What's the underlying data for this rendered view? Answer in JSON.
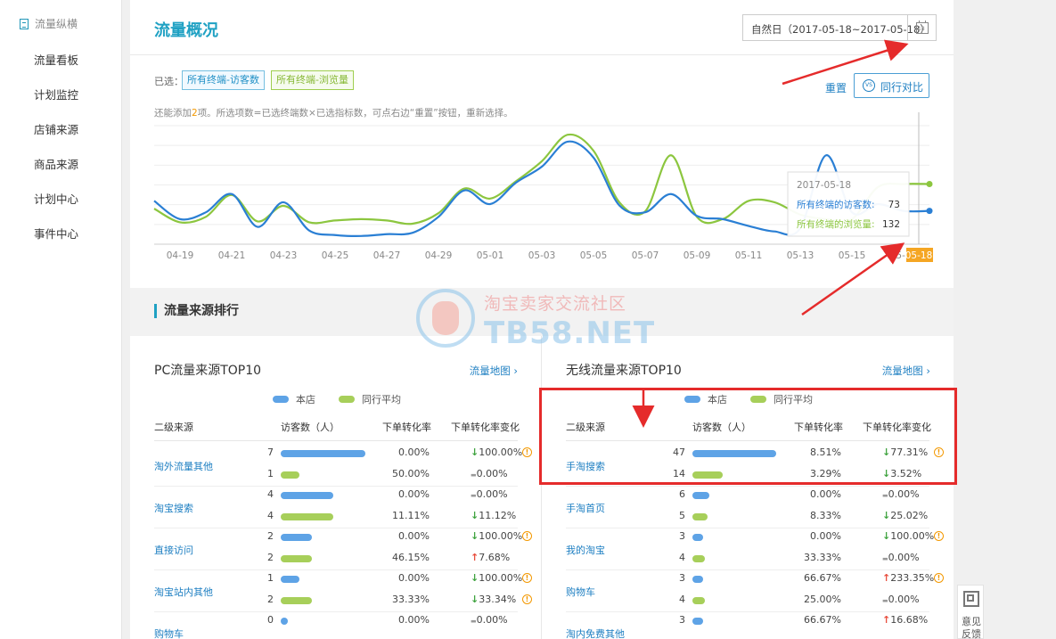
{
  "sidebar": {
    "header": "流量纵横",
    "items": [
      "流量看板",
      "计划监控",
      "店铺来源",
      "商品来源",
      "计划中心",
      "事件中心"
    ]
  },
  "header": {
    "title": "流量概况",
    "date_range": "自然日（2017-05-18~2017-05-18）",
    "calendar_day": "18"
  },
  "selection": {
    "label": "已选：",
    "tags": [
      "所有终端-访客数",
      "所有终端-浏览量"
    ],
    "reset": "重置",
    "compare": "同行对比",
    "compare_icon": "VS",
    "hint_prefix": "还能添加",
    "hint_num": "2",
    "hint_suffix": "项。所选项数=已选终端数×已选指标数，可点右边“重置”按钮，重新选择。"
  },
  "chart_data": {
    "type": "line",
    "x": [
      "04-18",
      "04-19",
      "04-20",
      "04-21",
      "04-22",
      "04-23",
      "04-24",
      "04-25",
      "04-26",
      "04-27",
      "04-28",
      "04-29",
      "04-30",
      "05-01",
      "05-02",
      "05-03",
      "05-04",
      "05-05",
      "05-06",
      "05-07",
      "05-08",
      "05-09",
      "05-10",
      "05-11",
      "05-12",
      "05-13",
      "05-14",
      "05-15",
      "05-16",
      "05-17",
      "05-18"
    ],
    "x_tick_labels": [
      "04-19",
      "04-21",
      "04-23",
      "04-25",
      "04-27",
      "04-29",
      "05-01",
      "05-03",
      "05-05",
      "05-07",
      "05-09",
      "05-11",
      "05-13",
      "05-15",
      "05-17",
      "05-18"
    ],
    "series": [
      {
        "name": "所有终端的访客数",
        "color": "#2a7fd4",
        "values": [
          95,
          55,
          70,
          110,
          38,
          92,
          30,
          20,
          18,
          22,
          25,
          60,
          118,
          88,
          135,
          170,
          225,
          190,
          85,
          70,
          110,
          62,
          55,
          40,
          28,
          35,
          195,
          70,
          88,
          73,
          73
        ]
      },
      {
        "name": "所有终端的浏览量",
        "color": "#8cc63f",
        "values": [
          78,
          48,
          60,
          108,
          50,
          84,
          48,
          52,
          55,
          52,
          45,
          68,
          122,
          100,
          138,
          182,
          240,
          205,
          92,
          72,
          195,
          60,
          55,
          95,
          92,
          65,
          55,
          55,
          125,
          132,
          132
        ]
      }
    ],
    "tooltip": {
      "date": "2017-05-18",
      "rows": [
        {
          "label": "所有终端的访客数:",
          "value": "73"
        },
        {
          "label": "所有终端的浏览量:",
          "value": "132"
        }
      ]
    },
    "ylim": [
      0,
      260
    ],
    "grid": true
  },
  "section": {
    "title": "流量来源排行"
  },
  "legend": {
    "own": "本店",
    "peer": "同行平均",
    "own_color": "#5ea3e6",
    "peer_color": "#a7cf5a"
  },
  "columns_header": {
    "source": "二级来源",
    "visitors": "访客数（人）",
    "conv": "下单转化率",
    "change": "下单转化率变化"
  },
  "pc": {
    "title": "PC流量来源TOP10",
    "map_link": "流量地图 ›",
    "rows": [
      {
        "name": "淘外流量其他",
        "own": {
          "count": "7",
          "pct": 1.0,
          "rate": "0.00%",
          "dir": "down",
          "change": "100.00%",
          "warn": true
        },
        "peer": {
          "count": "1",
          "pct": 0.22,
          "rate": "50.00%",
          "dir": "flat",
          "change": "0.00%",
          "warn": false
        }
      },
      {
        "name": "淘宝搜索",
        "own": {
          "count": "4",
          "pct": 0.62,
          "rate": "0.00%",
          "dir": "flat",
          "change": "0.00%",
          "warn": false
        },
        "peer": {
          "count": "4",
          "pct": 0.62,
          "rate": "11.11%",
          "dir": "down",
          "change": "11.12%",
          "warn": false
        }
      },
      {
        "name": "直接访问",
        "own": {
          "count": "2",
          "pct": 0.37,
          "rate": "0.00%",
          "dir": "down",
          "change": "100.00%",
          "warn": true
        },
        "peer": {
          "count": "2",
          "pct": 0.37,
          "rate": "46.15%",
          "dir": "up",
          "change": "7.68%",
          "warn": false
        }
      },
      {
        "name": "淘宝站内其他",
        "own": {
          "count": "1",
          "pct": 0.22,
          "rate": "0.00%",
          "dir": "down",
          "change": "100.00%",
          "warn": true
        },
        "peer": {
          "count": "2",
          "pct": 0.37,
          "rate": "33.33%",
          "dir": "down",
          "change": "33.34%",
          "warn": true
        }
      },
      {
        "name": "购物车",
        "own": {
          "count": "0",
          "pct": 0.08,
          "rate": "0.00%",
          "dir": "flat",
          "change": "0.00%",
          "warn": false
        },
        "peer": {
          "count": "",
          "pct": 0,
          "rate": "",
          "dir": "",
          "change": "",
          "warn": false
        }
      }
    ]
  },
  "mobile": {
    "title": "无线流量来源TOP10",
    "map_link": "流量地图 ›",
    "rows": [
      {
        "name": "手淘搜索",
        "own": {
          "count": "47",
          "pct": 1.0,
          "rate": "8.51%",
          "dir": "down",
          "change": "77.31%",
          "warn": true
        },
        "peer": {
          "count": "14",
          "pct": 0.36,
          "rate": "3.29%",
          "dir": "down",
          "change": "3.52%",
          "warn": false
        }
      },
      {
        "name": "手淘首页",
        "own": {
          "count": "6",
          "pct": 0.2,
          "rate": "0.00%",
          "dir": "flat",
          "change": "0.00%",
          "warn": false
        },
        "peer": {
          "count": "5",
          "pct": 0.18,
          "rate": "8.33%",
          "dir": "down",
          "change": "25.02%",
          "warn": false
        }
      },
      {
        "name": "我的淘宝",
        "own": {
          "count": "3",
          "pct": 0.13,
          "rate": "0.00%",
          "dir": "down",
          "change": "100.00%",
          "warn": true
        },
        "peer": {
          "count": "4",
          "pct": 0.15,
          "rate": "33.33%",
          "dir": "flat",
          "change": "0.00%",
          "warn": false
        }
      },
      {
        "name": "购物车",
        "own": {
          "count": "3",
          "pct": 0.13,
          "rate": "66.67%",
          "dir": "up",
          "change": "233.35%",
          "warn": true
        },
        "peer": {
          "count": "4",
          "pct": 0.15,
          "rate": "25.00%",
          "dir": "flat",
          "change": "0.00%",
          "warn": false
        }
      },
      {
        "name": "淘内免费其他",
        "own": {
          "count": "3",
          "pct": 0.13,
          "rate": "66.67%",
          "dir": "up",
          "change": "16.68%",
          "warn": false
        },
        "peer": {
          "count": "",
          "pct": 0,
          "rate": "",
          "dir": "",
          "change": "",
          "warn": false
        }
      }
    ]
  },
  "watermark": {
    "cn": "淘宝卖家交流社区",
    "en": "TB58.NET"
  },
  "feedback": {
    "label": "意见反馈"
  }
}
